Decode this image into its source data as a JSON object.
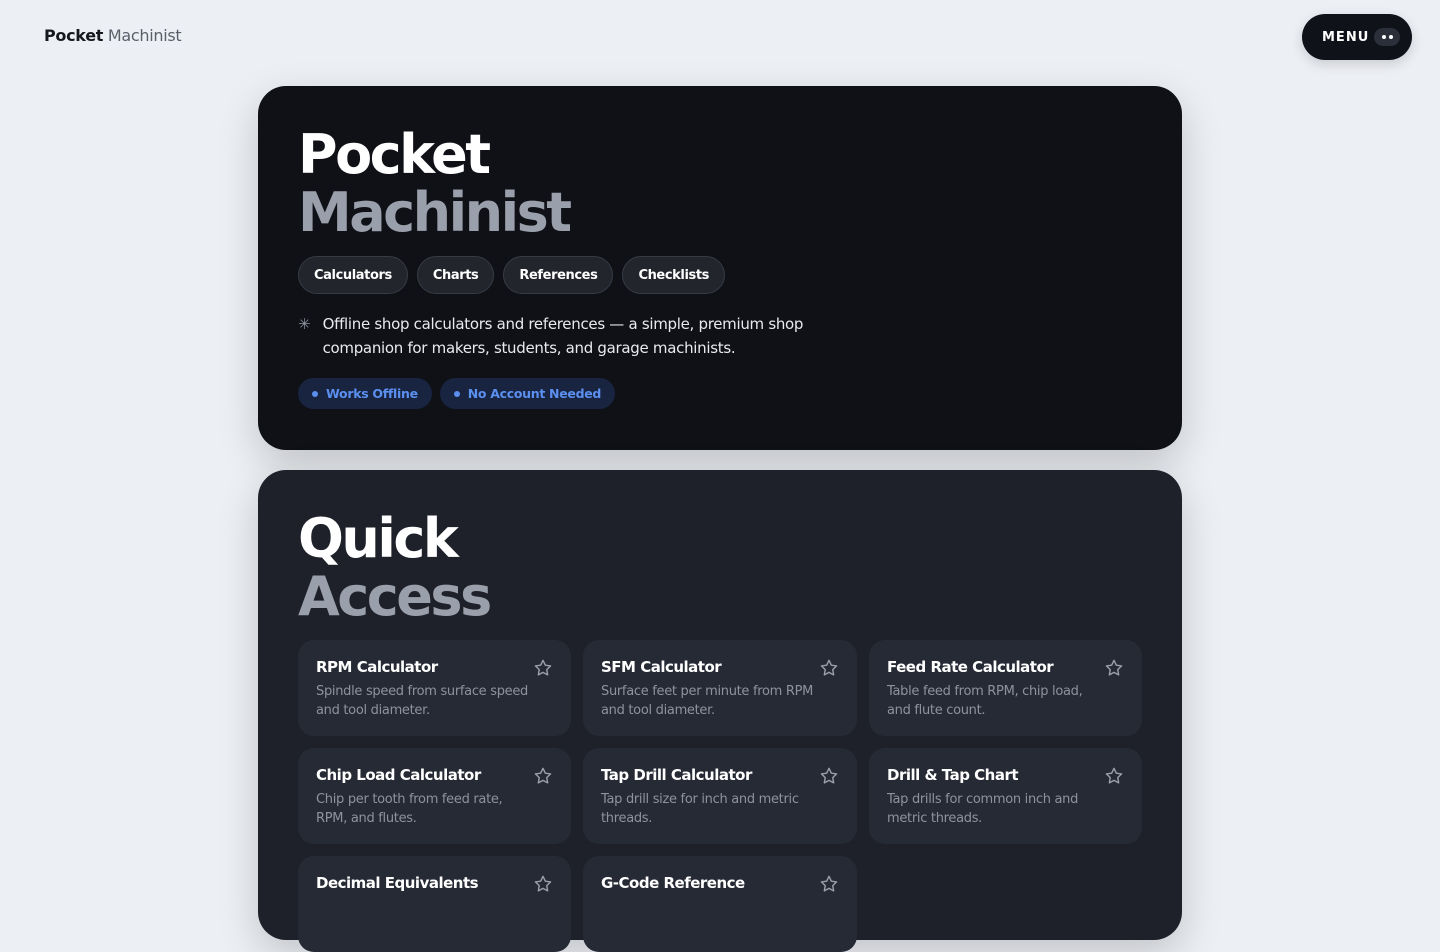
{
  "topbar": {
    "brand_bold": "Pocket",
    "brand_light": "Machinist",
    "menu_label": "MENU"
  },
  "hero": {
    "title_line1": "Pocket",
    "title_line2": "Machinist",
    "chips": [
      "Calculators",
      "Charts",
      "References",
      "Checklists"
    ],
    "description": "Offline shop calculators and references — a simple, premium shop companion for makers, students, and garage machinists.",
    "badges": [
      "Works Offline",
      "No Account Needed"
    ]
  },
  "quick_access": {
    "title_line1": "Quick",
    "title_line2": "Access",
    "cards": [
      {
        "title": "RPM Calculator",
        "desc": "Spindle speed from surface speed and tool diameter."
      },
      {
        "title": "SFM Calculator",
        "desc": "Surface feet per minute from RPM and tool diameter."
      },
      {
        "title": "Feed Rate Calculator",
        "desc": "Table feed from RPM, chip load, and flute count."
      },
      {
        "title": "Chip Load Calculator",
        "desc": "Chip per tooth from feed rate, RPM, and flutes."
      },
      {
        "title": "Tap Drill Calculator",
        "desc": "Tap drill size for inch and metric threads."
      },
      {
        "title": "Drill & Tap Chart",
        "desc": "Tap drills for common inch and metric threads."
      },
      {
        "title": "Decimal Equivalents",
        "desc": ""
      },
      {
        "title": "G-Code Reference",
        "desc": ""
      }
    ]
  },
  "colors": {
    "page_bg": "#eceff4",
    "hero_bg": "#0f1117",
    "panel_bg": "#1e2129",
    "card_bg": "#262a34",
    "badge_accent": "#5b8ff0"
  },
  "icons": {
    "hero_bullet": "sparkle-icon",
    "card_action": "star-outline-icon",
    "menu_toggle": "dots-icon"
  }
}
